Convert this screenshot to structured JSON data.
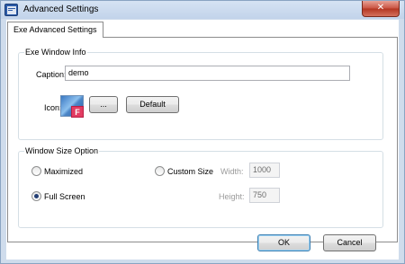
{
  "window": {
    "title": "Advanced Settings",
    "close_glyph": "✕"
  },
  "tabs": [
    {
      "label": "Exe Advanced Settings",
      "active": true
    }
  ],
  "exe_window_info": {
    "group_label": "Exe Window Info",
    "caption_label": "Caption:",
    "caption_value": "demo",
    "icon_label": "Icon:",
    "browse_label": "...",
    "default_label": "Default",
    "icon_badge_letter": "F"
  },
  "window_size_option": {
    "group_label": "Window Size Option",
    "maximized_label": "Maximized",
    "custom_size_label": "Custom Size",
    "full_screen_label": "Full Screen",
    "width_label": "Width:",
    "width_value": "1000",
    "height_label": "Height:",
    "height_value": "750",
    "selected": "full_screen"
  },
  "footer": {
    "ok_label": "OK",
    "cancel_label": "Cancel"
  },
  "colors": {
    "title_bar": "#c2d3ea",
    "close_button": "#c8523f",
    "accent_border": "#3c7fb1"
  }
}
